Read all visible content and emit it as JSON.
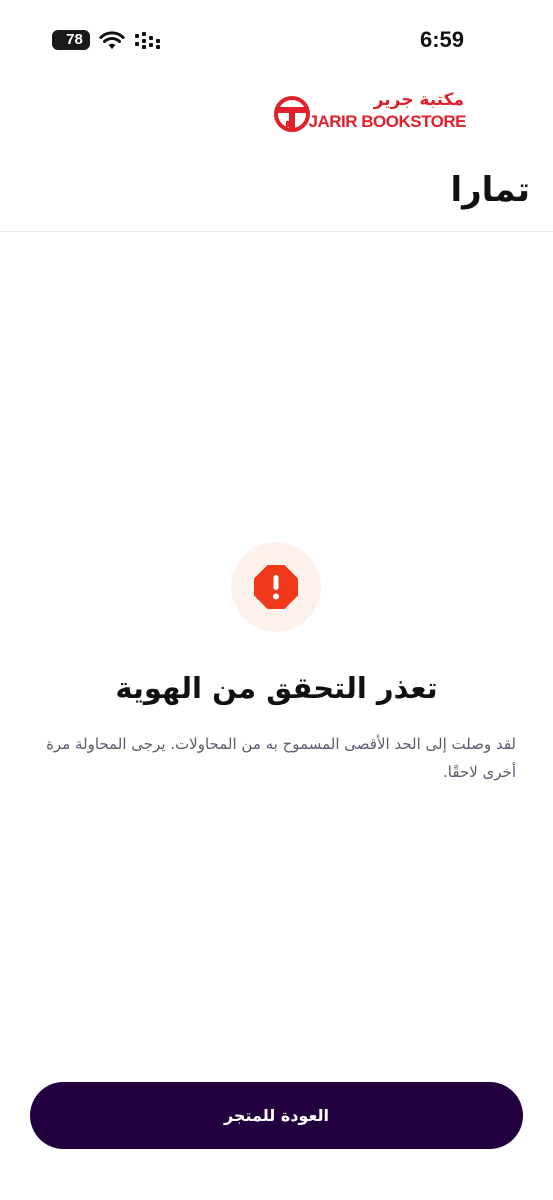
{
  "status_bar": {
    "battery": "78",
    "time": "6:59",
    "icons": [
      "battery-icon",
      "wifi-icon",
      "cellular-signal-icon"
    ]
  },
  "header": {
    "jarir_logo_arabic": "مكتبة جرير",
    "jarir_logo_english": "JARIR BOOKSTORE",
    "tamara_logo": "تمارا"
  },
  "error": {
    "icon": "alert-octagon-icon",
    "title": "تعذر التحقق من الهوية",
    "message": "لقد وصلت إلى الحد الأقصى المسموح به من المحاولات. يرجى المحاولة مرة أخرى لاحقًا."
  },
  "actions": {
    "back_to_store_label": "العودة للمتجر"
  },
  "colors": {
    "brand_red": "#e0202a",
    "button_bg": "#22003f",
    "alert_red": "#f0391a",
    "alert_badge_bg": "#fdf1ec",
    "message_text": "#5b5b72"
  }
}
